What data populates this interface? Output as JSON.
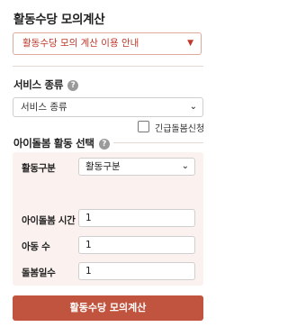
{
  "header": {
    "title": "활동수당 모의계산",
    "info_select": "활동수당 모의 계산 이용 안내"
  },
  "service": {
    "title": "서비스 종류",
    "select_value": "서비스 종류",
    "emergency_checkbox_label": "긴급돌봄신청",
    "emergency_checked": false
  },
  "activity": {
    "title": "아이돌봄 활동 선택",
    "rows": [
      {
        "label": "활동구분",
        "value": "활동구분",
        "type": "select"
      },
      {
        "label": "아이돌봄 시간",
        "value": "1",
        "type": "input"
      },
      {
        "label": "아동 수",
        "value": "1",
        "type": "input"
      },
      {
        "label": "돌봄일수",
        "value": "1",
        "type": "input"
      }
    ]
  },
  "submit_label": "활동수당 모의계산",
  "icons": {
    "help": "help-circle-icon",
    "chevron": "chevron-down-icon"
  },
  "colors": {
    "accent": "#c0543f",
    "panel_bg": "#fbf1ef",
    "info_text": "#c0392b"
  }
}
